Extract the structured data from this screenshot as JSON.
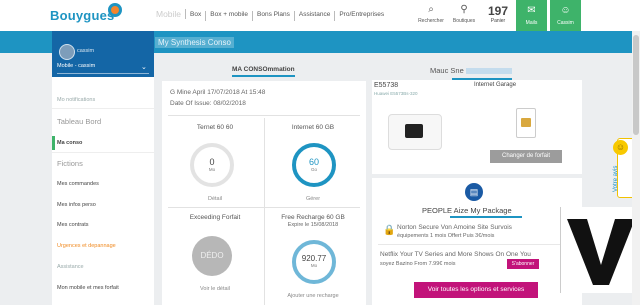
{
  "header": {
    "logo": "Bouygues",
    "nav": [
      "Mobile",
      "Box",
      "Box + mobile",
      "Bons Plans",
      "Assistance",
      "Pro/Entreprises"
    ],
    "icons": [
      {
        "name": "search-icon",
        "label": "Rechercher",
        "glyph": "⌕"
      },
      {
        "name": "store-icon",
        "label": "Boutiques",
        "glyph": "⚲"
      },
      {
        "name": "cart-icon",
        "label": "Panier",
        "glyph": "197"
      }
    ],
    "mail": {
      "label": "Mails",
      "glyph": "✉"
    },
    "account": {
      "label": "Cassim",
      "glyph": "☺"
    }
  },
  "band": {
    "title": "My Synthesis Conso"
  },
  "sidebar": {
    "user_name": "cassim",
    "line_select": "Mobile - cassim",
    "items": [
      {
        "label": "Mo notifications",
        "style": "muted"
      },
      {
        "label": "Tableau Bord",
        "style": "big"
      },
      {
        "label": "Ma conso",
        "style": "active"
      },
      {
        "label": "Fictions",
        "style": "big"
      },
      {
        "label": "Mes commandes",
        "style": "normal"
      },
      {
        "label": "Mes infos perso",
        "style": "normal"
      },
      {
        "label": "Mes contrats",
        "style": "normal"
      },
      {
        "label": "Urgences et depannage",
        "style": "orange"
      },
      {
        "label": "Assistance",
        "style": "muted"
      },
      {
        "label": "Mon mobile et mes forfait",
        "style": "normal"
      }
    ]
  },
  "tabs": {
    "conso": "MA CONSOmmation",
    "mauc": "Mauc Sne"
  },
  "conso": {
    "line1": "G Mine April 17/07/2018 At 15:48",
    "line2": "Date Of Issue: 08/02/2018",
    "cells": [
      {
        "title": "Ternet 60 60",
        "value": "0",
        "unit": "Mo",
        "sub": "Détail"
      },
      {
        "title": "Internet 60 GB",
        "value": "60",
        "unit": "Go",
        "sub": "Gérer"
      },
      {
        "title": "Exceeding Forfait",
        "value": "DÉDO",
        "unit": "",
        "sub": "Voir le détail"
      },
      {
        "title": "Free Recharge 60 GB",
        "subtitle": "Expire le 15/08/2018",
        "value": "920.77",
        "unit": "Mo",
        "sub": "Ajouter une recharge"
      }
    ]
  },
  "equipment": {
    "code": "E55738",
    "code_sub": "Huawei E5573Bs-320",
    "internet_garage": "Internet Garage",
    "change_btn": "Changer de forfait"
  },
  "package": {
    "title": "PEOPLE Aize My Package",
    "offer1": "Norton Secure Von Amoine Site Survois",
    "offer1_detail": "équipements  1 mois Offert   Puis 3€/mois",
    "offer2": "Netflix Your TV Series and More Shows On One You",
    "offer2_detail": "soyez Bazino From 7.99€   mois",
    "offer2_btn": "S'abonner",
    "all_btn": "Voir toutes les options et services"
  },
  "feedback": {
    "label": "Votre avis"
  },
  "colors": {
    "primary": "#1e94c2",
    "green": "#3eb36a",
    "pink": "#c2137a",
    "orange": "#f08b23"
  }
}
